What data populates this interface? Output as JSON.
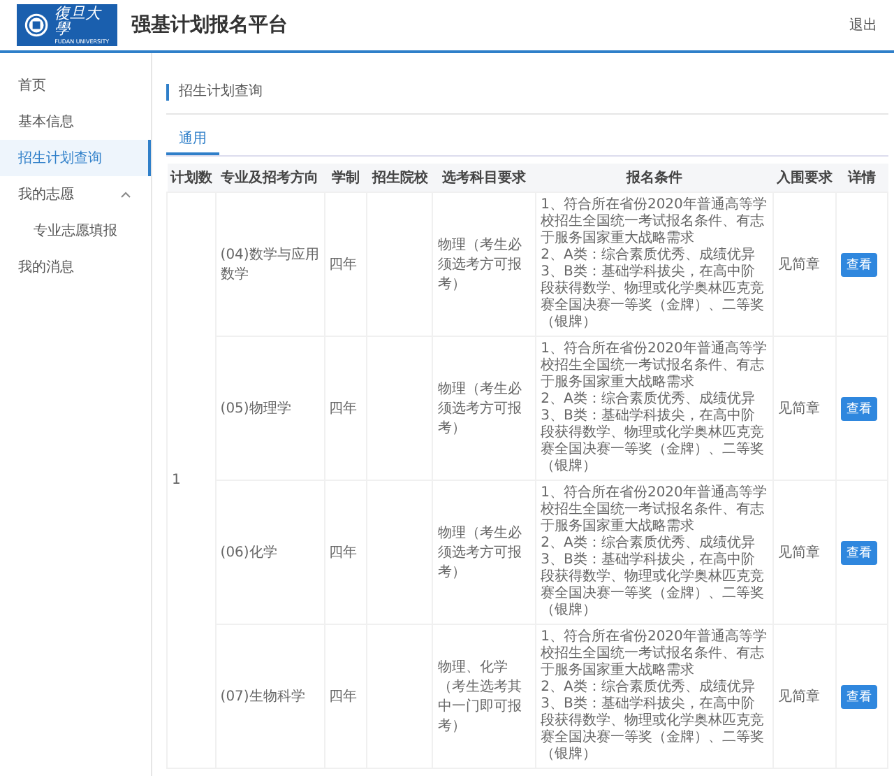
{
  "header": {
    "logo_text": "復旦大學",
    "logo_subtext": "FUDAN UNIVERSITY",
    "title": "强基计划报名平台",
    "logout": "退出"
  },
  "sidebar": {
    "items": [
      {
        "label": "首页",
        "selected": false
      },
      {
        "label": "基本信息",
        "selected": false
      },
      {
        "label": "招生计划查询",
        "selected": true
      },
      {
        "label": "我的志愿",
        "selected": false,
        "expanded": true,
        "children": [
          {
            "label": "专业志愿填报",
            "selected": false
          }
        ]
      },
      {
        "label": "我的消息",
        "selected": false
      }
    ]
  },
  "panel": {
    "title": "招生计划查询",
    "tabs": [
      {
        "label": "通用",
        "selected": true
      }
    ]
  },
  "table": {
    "columns": [
      "计划数",
      "专业及招考方向",
      "学制",
      "招生院校",
      "选考科目要求",
      "报名条件",
      "入围要求",
      "详情"
    ],
    "plan_count": "1",
    "rows": [
      {
        "major": "(04)数学与应用数学",
        "duration": "四年",
        "subjects": "物理（考生必须选考方可报考）",
        "conditions": [
          "1、符合所在省份2020年普通高等学校招生全国统一考试报名条件、有志于服务国家重大战略需求",
          "2、A类：综合素质优秀、成绩优异",
          "3、B类：基础学科拔尖，在高中阶段获得数学、物理或化学奥林匹克竞赛全国决赛一等奖（金牌）、二等奖（银牌）"
        ],
        "admission": "见简章",
        "action": "查看"
      },
      {
        "major": "(05)物理学",
        "duration": "四年",
        "subjects": "物理（考生必须选考方可报考）",
        "conditions": [
          "1、符合所在省份2020年普通高等学校招生全国统一考试报名条件、有志于服务国家重大战略需求",
          "2、A类：综合素质优秀、成绩优异",
          "3、B类：基础学科拔尖，在高中阶段获得数学、物理或化学奥林匹克竞赛全国决赛一等奖（金牌）、二等奖（银牌）"
        ],
        "admission": "见简章",
        "action": "查看"
      },
      {
        "major": "(06)化学",
        "duration": "四年",
        "subjects": "物理（考生必须选考方可报考）",
        "conditions": [
          "1、符合所在省份2020年普通高等学校招生全国统一考试报名条件、有志于服务国家重大战略需求",
          "2、A类：综合素质优秀、成绩优异",
          "3、B类：基础学科拔尖，在高中阶段获得数学、物理或化学奥林匹克竞赛全国决赛一等奖（金牌）、二等奖（银牌）"
        ],
        "admission": "见简章",
        "action": "查看"
      },
      {
        "major": "(07)生物科学",
        "duration": "四年",
        "subjects": "物理、化学（考生选考其中一门即可报考）",
        "conditions": [
          "1、符合所在省份2020年普通高等学校招生全国统一考试报名条件、有志于服务国家重大战略需求",
          "2、A类：综合素质优秀、成绩优异",
          "3、B类：基础学科拔尖，在高中阶段获得数学、物理或化学奥林匹克竞赛全国决赛一等奖（金牌）、二等奖（银牌）"
        ],
        "admission": "见简章",
        "action": "查看"
      }
    ]
  }
}
